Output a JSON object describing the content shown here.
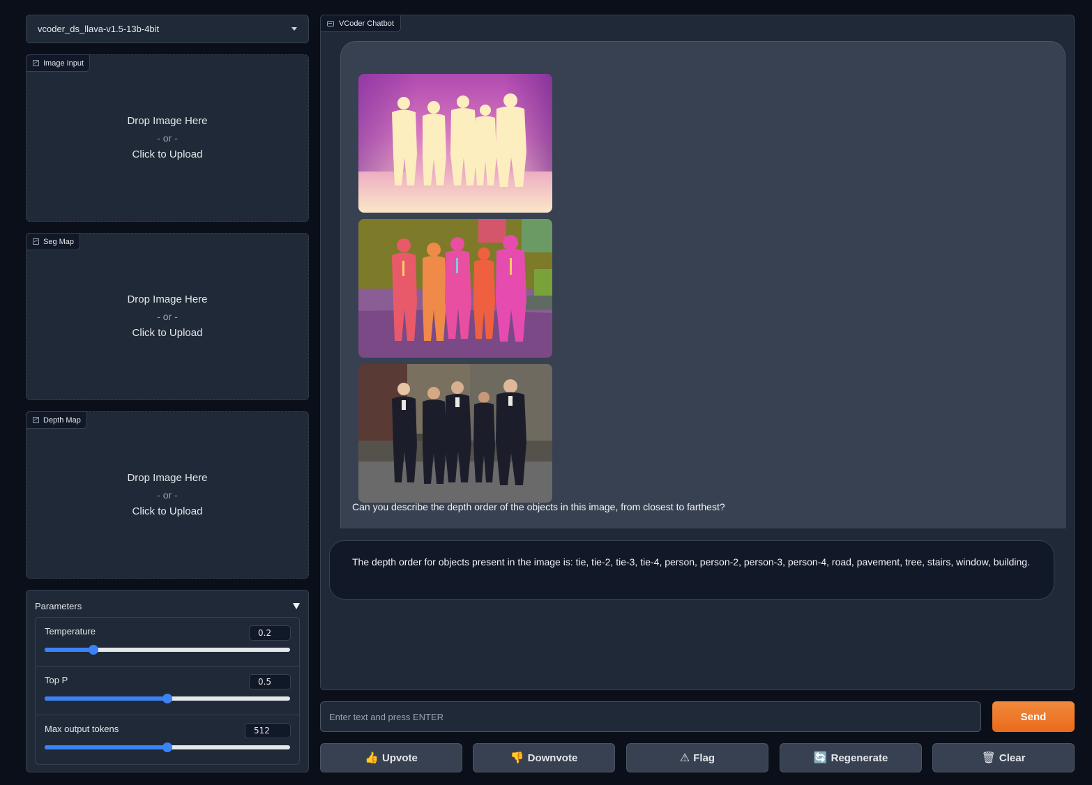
{
  "model_selector": {
    "value": "vcoder_ds_llava-v1.5-13b-4bit",
    "icon": "chevron-down-icon"
  },
  "uploads": [
    {
      "label": "Image Input",
      "drop": "Drop Image Here",
      "or": "- or -",
      "click": "Click to Upload"
    },
    {
      "label": "Seg Map",
      "drop": "Drop Image Here",
      "or": "- or -",
      "click": "Click to Upload"
    },
    {
      "label": "Depth Map",
      "drop": "Drop Image Here",
      "or": "- or -",
      "click": "Click to Upload"
    }
  ],
  "parameters": {
    "title": "Parameters",
    "sliders": [
      {
        "label": "Temperature",
        "value": "0.2",
        "min": 0,
        "max": 1,
        "fraction": 0.2
      },
      {
        "label": "Top P",
        "value": "0.5",
        "min": 0,
        "max": 1,
        "fraction": 0.5
      },
      {
        "label": "Max output tokens",
        "value": "512",
        "min": 0,
        "max": 1024,
        "fraction": 0.5
      }
    ]
  },
  "chatbot": {
    "label": "VCoder Chatbot",
    "user_message": "Can you describe the depth order of the objects in this image, from closest to farthest?",
    "bot_message": "The depth order for objects present in the image is: tie, tie-2, tie-3, tie-4, person, person-2, person-3, person-4, road, pavement, tree, stairs, window, building."
  },
  "input": {
    "placeholder": "Enter text and press ENTER"
  },
  "buttons": {
    "send": "Send",
    "upvote": "Upvote",
    "downvote": "Downvote",
    "flag": "Flag",
    "regenerate": "Regenerate",
    "clear": "Clear"
  },
  "colors": {
    "accent": "#ea6a1b",
    "slider": "#3b82f6",
    "background": "#0b0f19",
    "panel": "#1f2937"
  }
}
